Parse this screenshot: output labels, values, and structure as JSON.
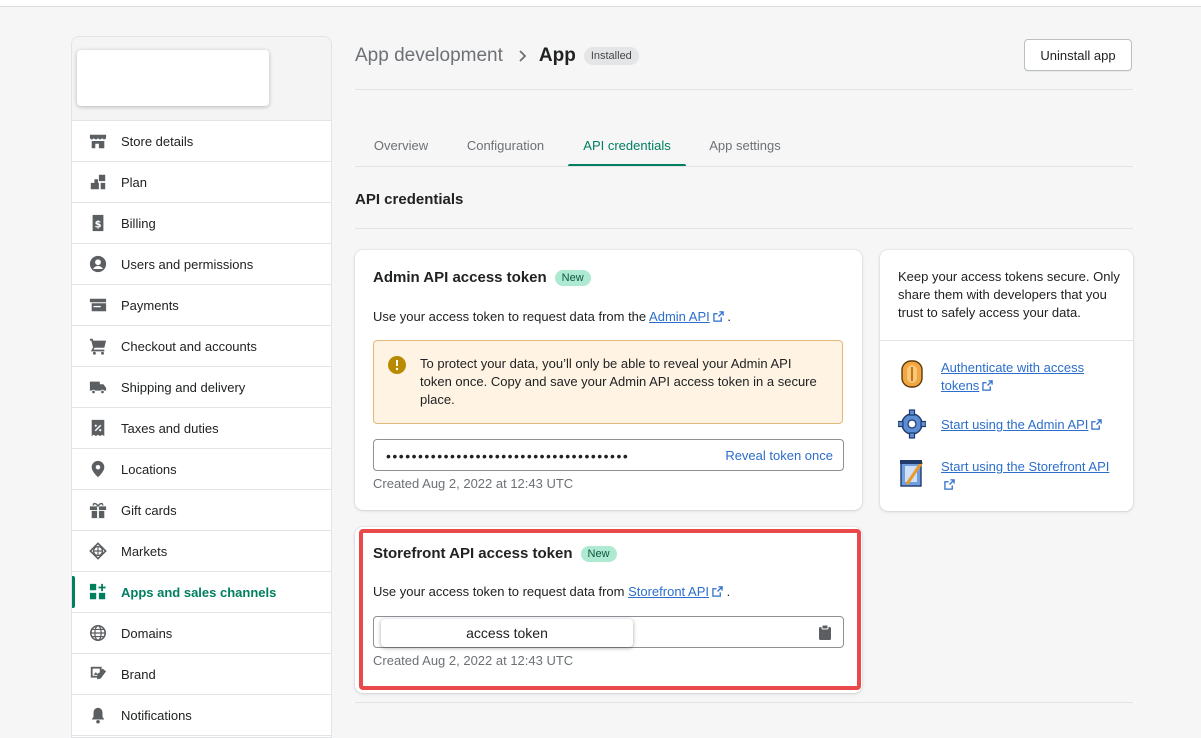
{
  "sidebar": {
    "items": [
      {
        "label": "Store details",
        "icon": "store-icon"
      },
      {
        "label": "Plan",
        "icon": "plan-icon"
      },
      {
        "label": "Billing",
        "icon": "billing-icon"
      },
      {
        "label": "Users and permissions",
        "icon": "user-icon"
      },
      {
        "label": "Payments",
        "icon": "payments-icon"
      },
      {
        "label": "Checkout and accounts",
        "icon": "cart-icon"
      },
      {
        "label": "Shipping and delivery",
        "icon": "truck-icon"
      },
      {
        "label": "Taxes and duties",
        "icon": "tax-icon"
      },
      {
        "label": "Locations",
        "icon": "location-pin-icon"
      },
      {
        "label": "Gift cards",
        "icon": "gift-icon"
      },
      {
        "label": "Markets",
        "icon": "globe-markets-icon"
      },
      {
        "label": "Apps and sales channels",
        "icon": "apps-icon",
        "active": true
      },
      {
        "label": "Domains",
        "icon": "domains-globe-icon"
      },
      {
        "label": "Brand",
        "icon": "brand-icon"
      },
      {
        "label": "Notifications",
        "icon": "bell-icon"
      }
    ]
  },
  "header": {
    "breadcrumb_parent": "App development",
    "title": "App",
    "status_badge": "Installed",
    "uninstall_label": "Uninstall app"
  },
  "tabs": [
    {
      "label": "Overview"
    },
    {
      "label": "Configuration"
    },
    {
      "label": "API credentials",
      "active": true
    },
    {
      "label": "App settings"
    }
  ],
  "section_title": "API credentials",
  "admin_card": {
    "title": "Admin API access token",
    "badge": "New",
    "desc_prefix": "Use your access token to request data from the ",
    "link": "Admin API",
    "desc_suffix": " .",
    "warning": "To protect your data, you’ll only be able to reveal your Admin API token once. Copy and save your Admin API access token in a secure place.",
    "masked_token": "••••••••••••••••••••••••••••••••••••••",
    "reveal_label": "Reveal token once",
    "created": "Created Aug 2, 2022 at 12:43 UTC"
  },
  "storefront_card": {
    "title": "Storefront API access token",
    "badge": "New",
    "desc_prefix": "Use your access token to request data from ",
    "link": "Storefront API",
    "desc_suffix": " .",
    "token_overlay": "access token",
    "created": "Created Aug 2, 2022 at 12:43 UTC"
  },
  "side_card": {
    "text": "Keep your access tokens secure. Only share them with developers that you trust to safely access your data.",
    "links": [
      {
        "label": "Authenticate with access tokens",
        "icon": "coin-icon"
      },
      {
        "label": "Start using the Admin API",
        "icon": "gear-icon"
      },
      {
        "label": "Start using the Storefront API",
        "icon": "storefront-icon"
      }
    ]
  },
  "colors": {
    "accent_green": "#008060",
    "link_blue": "#2c6ecb",
    "highlight_red": "#e9494a",
    "warning_bg": "#fff4e4"
  }
}
